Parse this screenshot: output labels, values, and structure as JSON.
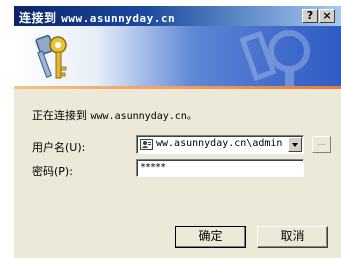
{
  "window": {
    "title_prefix": "连接到",
    "title_host": "www.asunnyday.cn",
    "help_label": "?",
    "close_label": "×"
  },
  "status": {
    "prefix": "正在连接到",
    "host": "www.asunnyday.cn。"
  },
  "form": {
    "username_label": "用户名(U):",
    "username_value": "ww.asunnyday.cn\\admin",
    "browse_label": "...",
    "password_label": "密码(P):",
    "password_value": "*****"
  },
  "buttons": {
    "ok_label": "确定",
    "cancel_label": "取消"
  },
  "colors": {
    "titlebar_start": "#0a246a",
    "titlebar_end": "#a6caf0",
    "dialog_bg": "#ece9d8",
    "banner_accent": "#2f5bc5"
  },
  "icons": {
    "banner": "keys-icon",
    "username_combo": "user-card-icon",
    "combo_dropdown": "chevron-down-icon"
  }
}
